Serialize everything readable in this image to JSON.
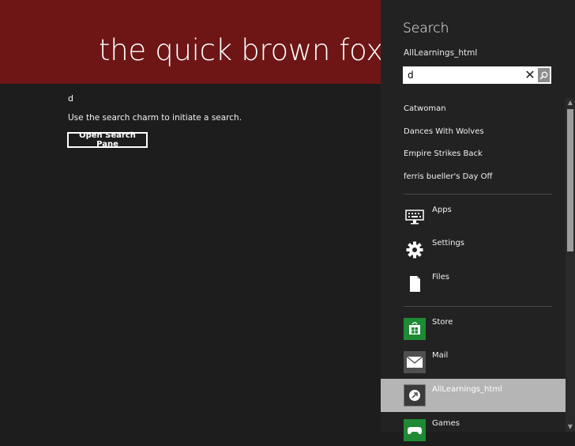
{
  "app": {
    "title": "the quick brown fox",
    "query": "d",
    "hint": "Use the search charm to initiate a search.",
    "open_button": "Open Search Pane",
    "header_color": "#6e1616"
  },
  "search_pane": {
    "title": "Search",
    "scope": "AllLearnings_html",
    "input_value": "d",
    "clear_icon": "close-icon",
    "go_icon": "magnifier-icon",
    "suggestions": [
      "Catwoman",
      "Dances With Wolves",
      "Empire Strikes Back",
      "ferris bueller's Day Off"
    ],
    "system_scopes": [
      {
        "label": "Apps",
        "icon": "keyboard-icon"
      },
      {
        "label": "Settings",
        "icon": "gear-icon"
      },
      {
        "label": "Files",
        "icon": "file-icon"
      }
    ],
    "app_scopes": [
      {
        "label": "Store",
        "icon": "store-icon",
        "color": "#1e8a34"
      },
      {
        "label": "Mail",
        "icon": "mail-icon",
        "color": "#505050"
      },
      {
        "label": "AllLearnings_html",
        "icon": "app-icon",
        "selected": true
      },
      {
        "label": "Games",
        "icon": "games-icon",
        "color": "#1e8a34"
      }
    ]
  }
}
